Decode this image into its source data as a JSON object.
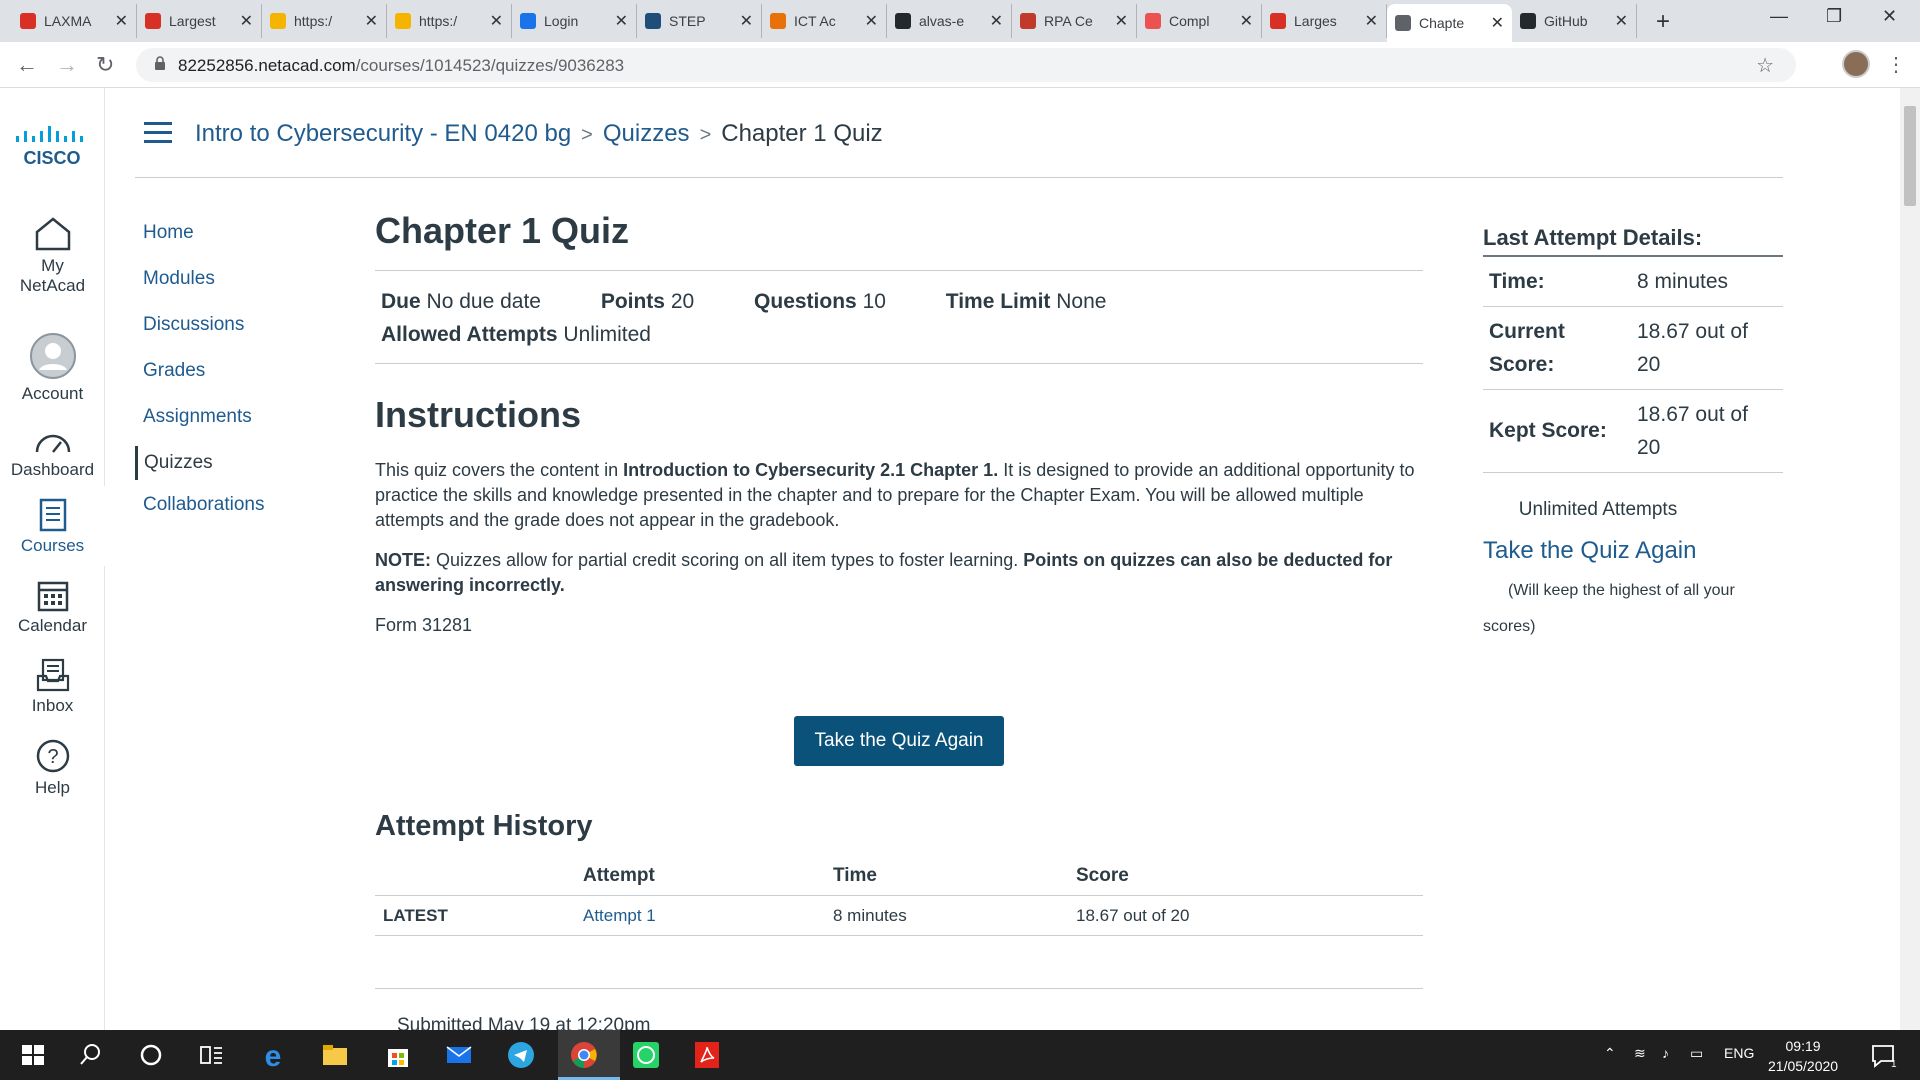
{
  "browser": {
    "tabs": [
      {
        "label": "LAXMA",
        "icon": "gmail-icon",
        "color": "#d93025"
      },
      {
        "label": "Largest",
        "icon": "tg-icon",
        "color": "#d93025"
      },
      {
        "label": "https:/",
        "icon": "folder-icon",
        "color": "#f4b400"
      },
      {
        "label": "https:/",
        "icon": "folder-icon",
        "color": "#f4b400"
      },
      {
        "label": "Login",
        "icon": "cloud-icon",
        "color": "#1a73e8"
      },
      {
        "label": "STEP",
        "icon": "step-icon",
        "color": "#1f4e79"
      },
      {
        "label": "ICT Ac",
        "icon": "ict-icon",
        "color": "#e8710a"
      },
      {
        "label": "alvas-e",
        "icon": "github-icon",
        "color": "#24292e"
      },
      {
        "label": "RPA Ce",
        "icon": "rpa-icon",
        "color": "#c0392b"
      },
      {
        "label": "Compl",
        "icon": "udemy-icon",
        "color": "#ec5252"
      },
      {
        "label": "Larges",
        "icon": "tg-icon",
        "color": "#d93025"
      },
      {
        "label": "Chapte",
        "icon": "globe-icon",
        "color": "#5f6368"
      },
      {
        "label": "GitHub",
        "icon": "github-icon",
        "color": "#24292e"
      }
    ],
    "url_host": "82252856.netacad.com",
    "url_path": "/courses/1014523/quizzes/9036283"
  },
  "global_nav": {
    "logo_text": "CISCO",
    "items": [
      {
        "label_line1": "My",
        "label_line2": "NetAcad"
      },
      {
        "label_line1": "Account",
        "label_line2": ""
      },
      {
        "label_line1": "Dashboard",
        "label_line2": ""
      },
      {
        "label_line1": "Courses",
        "label_line2": ""
      },
      {
        "label_line1": "Calendar",
        "label_line2": ""
      },
      {
        "label_line1": "Inbox",
        "label_line2": ""
      },
      {
        "label_line1": "Help",
        "label_line2": ""
      }
    ]
  },
  "breadcrumb": {
    "course": "Intro to Cybersecurity - EN 0420 bg",
    "section": "Quizzes",
    "current": "Chapter 1 Quiz",
    "separator": ">"
  },
  "course_nav": [
    "Home",
    "Modules",
    "Discussions",
    "Grades",
    "Assignments",
    "Quizzes",
    "Collaborations"
  ],
  "quiz": {
    "title": "Chapter 1 Quiz",
    "due_label": "Due",
    "due_value": "No due date",
    "points_label": "Points",
    "points_value": "20",
    "questions_label": "Questions",
    "questions_value": "10",
    "time_limit_label": "Time Limit",
    "time_limit_value": "None",
    "attempts_label": "Allowed Attempts",
    "attempts_value": "Unlimited",
    "instructions_title": "Instructions",
    "para1_a": "This quiz covers the content in ",
    "para1_b": "Introduction to Cybersecurity 2.1 Chapter 1.",
    "para1_c": " It is designed to provide an additional opportunity to practice the skills and knowledge presented in the chapter and to prepare for the Chapter Exam. You will be allowed multiple attempts and the grade does not appear in the gradebook.",
    "note_label": "NOTE:",
    "note_text": " Quizzes allow for partial credit scoring on all item types to foster learning. ",
    "note_bold": "Points on quizzes can also be deducted for answering incorrectly.",
    "form": "Form 31281",
    "take_again_button": "Take the Quiz Again"
  },
  "history": {
    "title": "Attempt History",
    "columns": [
      "",
      "Attempt",
      "Time",
      "Score"
    ],
    "rows": [
      {
        "tag": "LATEST",
        "attempt": "Attempt 1",
        "time": "8 minutes",
        "score": "18.67 out of 20"
      }
    ],
    "submitted": "Submitted May 19 at 12:20pm"
  },
  "sidebar": {
    "heading": "Last Attempt Details:",
    "time_label": "Time:",
    "time_value": "8 minutes",
    "current_label_1": "Current",
    "current_label_2": "Score:",
    "current_value_1": "18.67 out of",
    "current_value_2": "20",
    "kept_label": "Kept Score:",
    "kept_value_1": "18.67 out of",
    "kept_value_2": "20",
    "unlimited": "Unlimited Attempts",
    "take_again_link": "Take the Quiz Again",
    "keep_note_1": "(Will keep the highest of all your",
    "keep_note_2": "scores)"
  },
  "taskbar": {
    "lang": "ENG",
    "time": "09:19",
    "date": "21/05/2020",
    "notifications": "1"
  }
}
